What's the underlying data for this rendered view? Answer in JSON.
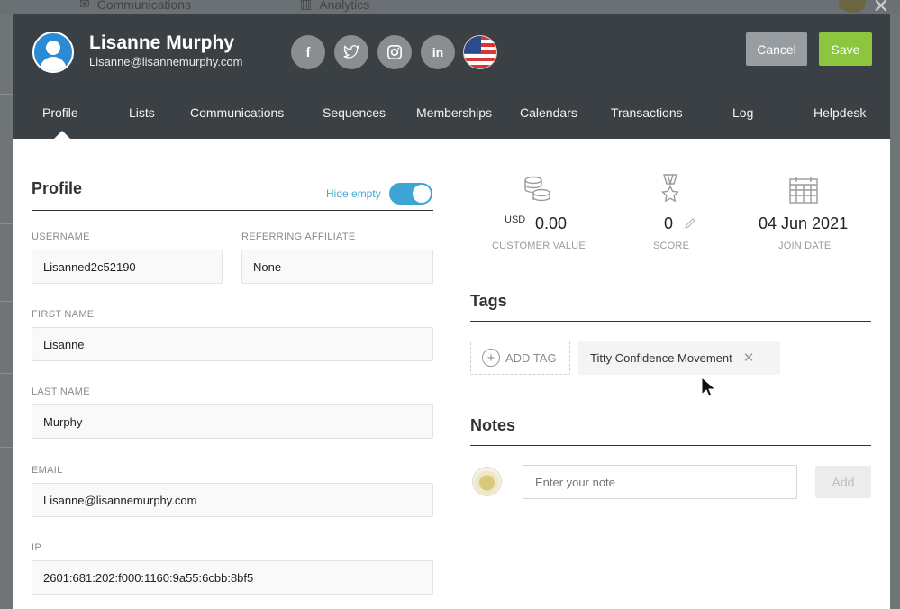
{
  "backdrop": {
    "nav_items": [
      {
        "label": "Communications",
        "icon": "envelope-icon"
      },
      {
        "label": "Analytics",
        "icon": "bar-chart-icon"
      }
    ]
  },
  "header": {
    "name": "Lisanne Murphy",
    "email": "Lisanne@lisannemurphy.com",
    "social": [
      {
        "icon": "facebook-icon",
        "glyph": "f"
      },
      {
        "icon": "twitter-icon",
        "glyph": "🐦"
      },
      {
        "icon": "instagram-icon",
        "glyph": "◎"
      },
      {
        "icon": "linkedin-icon",
        "glyph": "in"
      }
    ],
    "flag_icon": "us-flag-icon",
    "cancel_label": "Cancel",
    "save_label": "Save"
  },
  "nav": {
    "tabs": [
      "Profile",
      "Lists",
      "Communications",
      "Sequences",
      "Memberships",
      "Calendars",
      "Transactions",
      "Log",
      "Helpdesk"
    ],
    "active": "Profile"
  },
  "profile": {
    "title": "Profile",
    "hide_empty_label": "Hide empty",
    "hide_empty_on": true,
    "fields": {
      "username_label": "USERNAME",
      "username_value": "Lisanned2c52190",
      "affiliate_label": "REFERRING AFFILIATE",
      "affiliate_value": "None",
      "first_name_label": "FIRST NAME",
      "first_name_value": "Lisanne",
      "last_name_label": "LAST NAME",
      "last_name_value": "Murphy",
      "email_label": "EMAIL",
      "email_value": "Lisanne@lisannemurphy.com",
      "ip_label": "IP",
      "ip_value": "2601:681:202:f000:1160:9a55:6cbb:8bf5"
    }
  },
  "stats": {
    "customer_value_currency": "USD",
    "customer_value": "0.00",
    "customer_value_label": "CUSTOMER VALUE",
    "score": "0",
    "score_label": "SCORE",
    "join_date": "04 Jun 2021",
    "join_date_label": "JOIN DATE"
  },
  "tags": {
    "title": "Tags",
    "add_label": "ADD TAG",
    "items": [
      "Titty Confidence Movement"
    ]
  },
  "notes": {
    "title": "Notes",
    "placeholder": "Enter your note",
    "add_label": "Add"
  },
  "colors": {
    "header_bg": "#3b4044",
    "save": "#8cc63f",
    "cancel": "#989da1",
    "toggle": "#3ba6d6"
  }
}
